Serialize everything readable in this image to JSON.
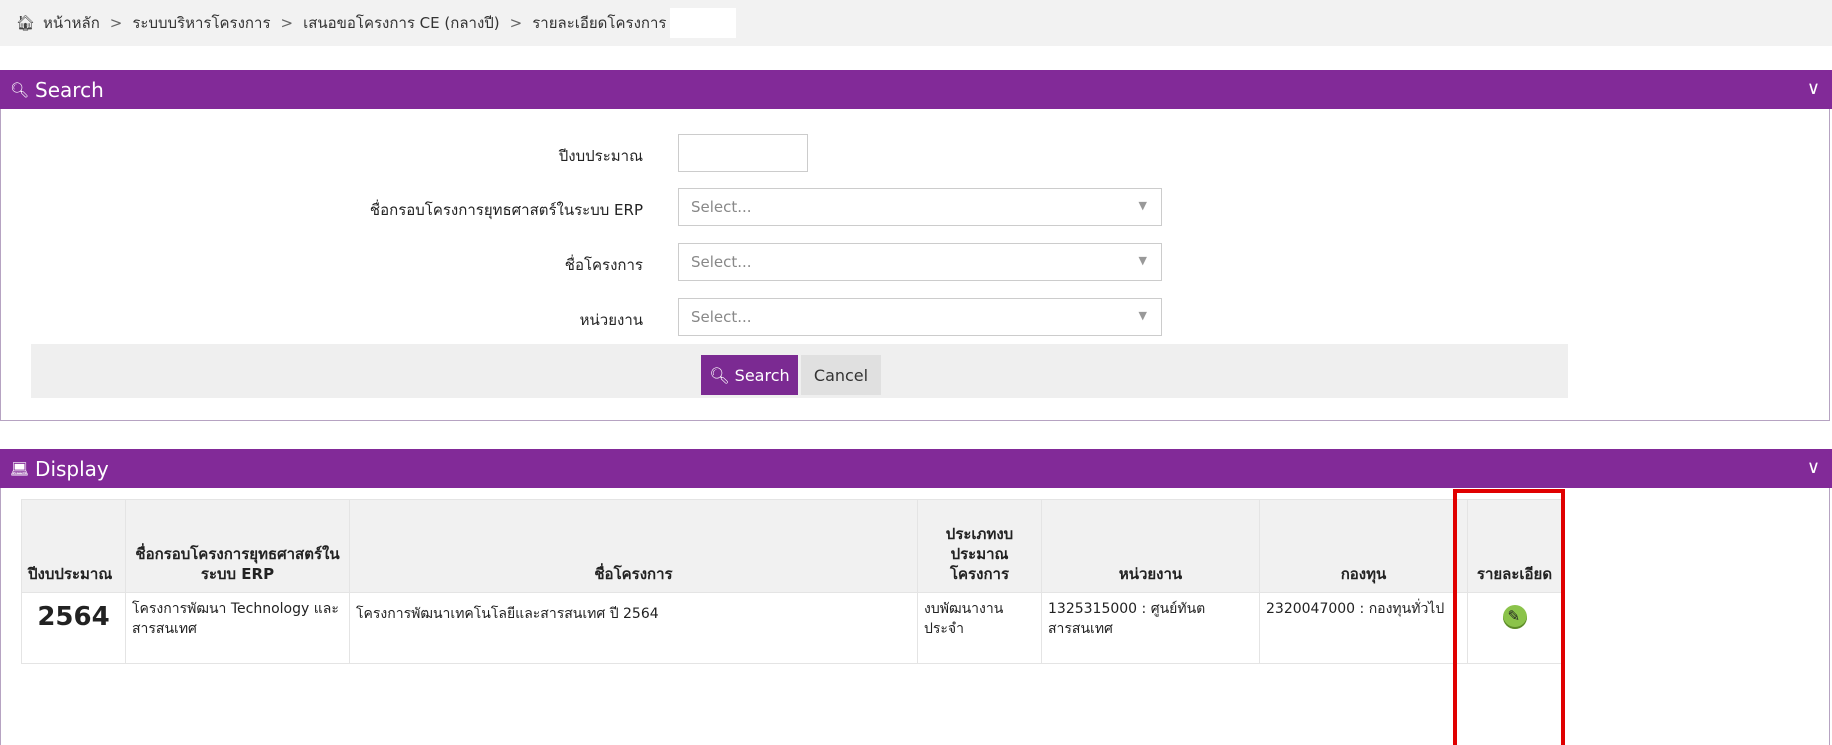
{
  "breadcrumb": {
    "items": [
      "หน้าหลัก",
      "ระบบบริหารโครงการ",
      "เสนอขอโครงการ CE (กลางปี)",
      "รายละเอียดโครงการ"
    ],
    "separator": ">"
  },
  "search_panel": {
    "title": "Search",
    "fields": {
      "year_label": "ปีงบประมาณ",
      "year_value": "",
      "framework_label": "ชื่อกรอบโครงการยุทธศาสตร์ในระบบ ERP",
      "framework_placeholder": "Select...",
      "project_label": "ชื่อโครงการ",
      "project_placeholder": "Select...",
      "unit_label": "หน่วยงาน",
      "unit_placeholder": "Select..."
    },
    "search_button": "Search",
    "cancel_button": "Cancel"
  },
  "display_panel": {
    "title": "Display",
    "columns": [
      "ปีงบประมาณ",
      "ชื่อกรอบโครงการยุทธศาสตร์ในระบบ ERP",
      "ชื่อโครงการ",
      "ประเภทงบประมาณโครงการ",
      "หน่วยงาน",
      "กองทุน",
      "รายละเอียด"
    ],
    "rows": [
      {
        "year": "2564",
        "framework": "โครงการพัฒนา Technology และสารสนเทศ",
        "project": "โครงการพัฒนาเทคโนโลยีและสารสนเทศ ปี 2564",
        "budget_type": "งบพัฒนางานประจำ",
        "unit": "1325315000 : ศูนย์ทันตสารสนเทศ",
        "fund": "2320047000 : กองทุนทั่วไป"
      }
    ]
  },
  "colors": {
    "panel_header": "#822a98",
    "search_button": "#7b2a92",
    "highlight": "#e00000",
    "edit_icon": "#8bc34a"
  },
  "icons": [
    "home-icon",
    "search-icon",
    "laptop-icon",
    "chevron-down-icon",
    "edit-icon"
  ]
}
